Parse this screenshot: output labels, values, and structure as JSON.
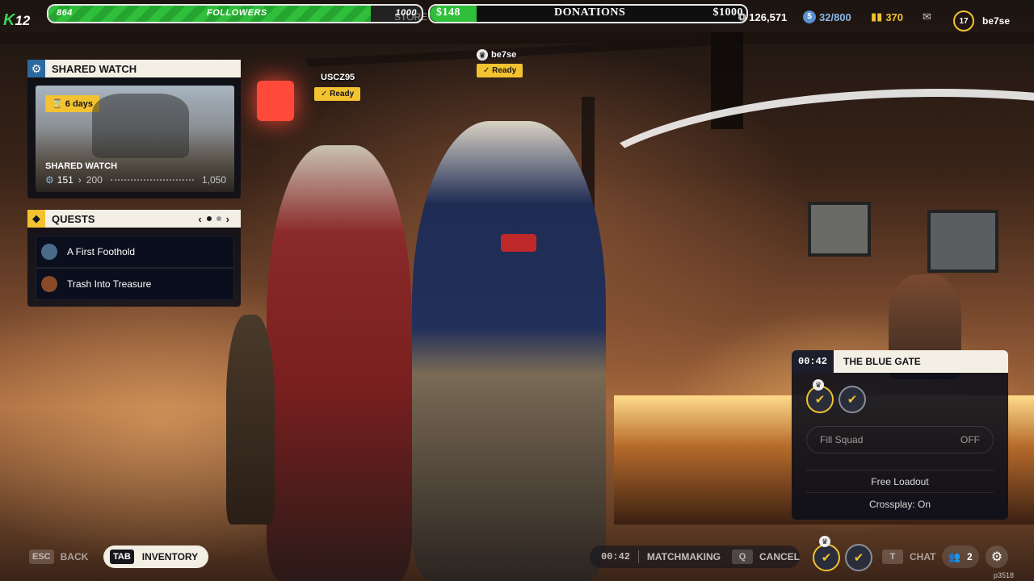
{
  "topbar": {
    "logo_k": "K",
    "logo_num": "12",
    "followers": {
      "current": "864",
      "label": "FOLLOWERS",
      "goal": "1000",
      "progress": 0.864
    },
    "store_label": "STORE",
    "donations": {
      "amount": "$148",
      "label": "DONATIONS",
      "goal": "$1000",
      "progress": 0.148
    },
    "currency1": "126,571",
    "currency2": "32/800",
    "currency3": "370",
    "level": "17",
    "username": "be7se"
  },
  "shared_watch": {
    "title": "SHARED WATCH",
    "days": "6  days",
    "card_title": "SHARED WATCH",
    "progress_current": "151",
    "progress_next": "200",
    "progress_total": "1,050"
  },
  "quests": {
    "title": "QUESTS",
    "items": [
      {
        "label": "A First Foothold"
      },
      {
        "label": "Trash Into Treasure"
      }
    ]
  },
  "players": [
    {
      "name": "USCZ95",
      "status": "Ready"
    },
    {
      "name": "be7se",
      "status": "Ready"
    }
  ],
  "gate": {
    "timer": "00:42",
    "title": "THE BLUE GATE",
    "fill_squad_label": "Fill Squad",
    "fill_squad_value": "OFF",
    "loadout": "Free Loadout",
    "crossplay": "Crossplay: On"
  },
  "bottombar": {
    "back_key": "ESC",
    "back_label": "BACK",
    "inventory_key": "TAB",
    "inventory_label": "INVENTORY",
    "mm_timer": "00:42",
    "mm_label": "MATCHMAKING",
    "cancel_key": "Q",
    "cancel_label": "CANCEL",
    "chat_key": "T",
    "chat_label": "CHAT",
    "party_count": "2",
    "build_id": "p3518"
  },
  "colors": {
    "accent": "#f2c230",
    "green": "#2fbf3a",
    "panel_head": "#f3efe4"
  }
}
